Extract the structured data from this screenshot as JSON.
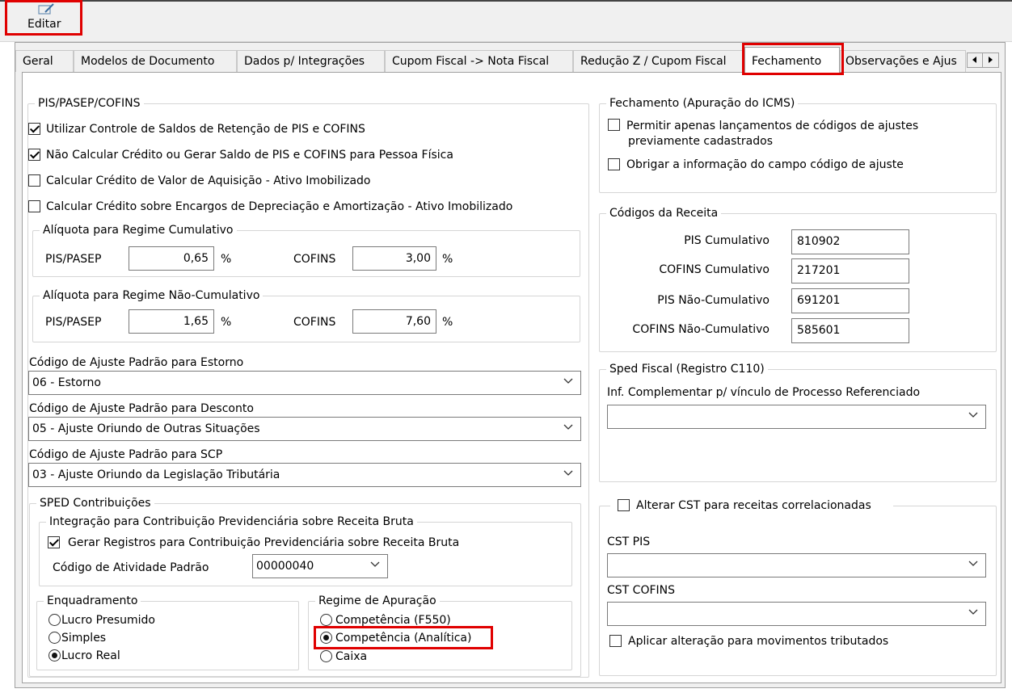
{
  "toolbar": {
    "edit_label": "Editar"
  },
  "tabs": [
    "Geral",
    "Modelos de Documento",
    "Dados p/ Integrações",
    "Cupom Fiscal -> Nota Fiscal",
    "Redução Z / Cupom Fiscal",
    "Fechamento",
    "Observações e Ajus"
  ],
  "active_tab": "Fechamento",
  "pis": {
    "legend": "PIS/PASEP/COFINS",
    "options": [
      {
        "label": "Utilizar Controle de Saldos de Retenção de PIS e COFINS",
        "checked": true
      },
      {
        "label": "Não Calcular Crédito ou Gerar Saldo de PIS e COFINS para Pessoa Física",
        "checked": true
      },
      {
        "label": "Calcular Crédito de Valor de Aquisição - Ativo Imobilizado",
        "checked": false
      },
      {
        "label": "Calcular Crédito sobre Encargos de Depreciação e Amortização - Ativo Imobilizado",
        "checked": false
      }
    ],
    "cumulativo": {
      "legend": "Alíquota para Regime Cumulativo",
      "pis_label": "PIS/PASEP",
      "pis_value": "0,65",
      "cofins_label": "COFINS",
      "cofins_value": "3,00",
      "unit": "%"
    },
    "nao_cumulativo": {
      "legend": "Alíquota para Regime Não-Cumulativo",
      "pis_label": "PIS/PASEP",
      "pis_value": "1,65",
      "cofins_label": "COFINS",
      "cofins_value": "7,60",
      "unit": "%"
    },
    "estorno": {
      "label": "Código de Ajuste Padrão para Estorno",
      "value": "06 - Estorno"
    },
    "desconto": {
      "label": "Código de Ajuste Padrão para Desconto",
      "value": "05 - Ajuste Oriundo de Outras Situações"
    },
    "scp": {
      "label": "Código de Ajuste Padrão para SCP",
      "value": "03 - Ajuste Oriundo da Legislação Tributária"
    }
  },
  "sped": {
    "legend": "SPED Contribuições",
    "integracao": {
      "legend": "Integração para Contribuição Previdenciária sobre Receita Bruta",
      "gerar_label": "Gerar Registros para Contribuição Previdenciária sobre Receita Bruta",
      "gerar_checked": true,
      "atividade_label": "Código de Atividade Padrão",
      "atividade_value": "00000040"
    },
    "enquadramento": {
      "legend": "Enquadramento",
      "options": [
        {
          "label": "Lucro Presumido",
          "selected": false
        },
        {
          "label": "Simples",
          "selected": false
        },
        {
          "label": "Lucro Real",
          "selected": true
        }
      ]
    },
    "regime": {
      "legend": "Regime de Apuração",
      "options": [
        {
          "label": "Competência (F550)",
          "selected": false
        },
        {
          "label": "Competência (Analítica)",
          "selected": true
        },
        {
          "label": "Caixa",
          "selected": false
        }
      ]
    }
  },
  "fechamento": {
    "legend": "Fechamento (Apuração do ICMS)",
    "permitir_line1": "Permitir apenas lançamentos de códigos de ajustes",
    "permitir_line2": "previamente cadastrados",
    "permitir_checked": false,
    "obrigar_label": "Obrigar a informação do campo código de ajuste",
    "obrigar_checked": false
  },
  "receita": {
    "legend": "Códigos da Receita",
    "rows": [
      {
        "label": "PIS Cumulativo",
        "value": "810902"
      },
      {
        "label": "COFINS Cumulativo",
        "value": "217201"
      },
      {
        "label": "PIS Não-Cumulativo",
        "value": "691201"
      },
      {
        "label": "COFINS Não-Cumulativo",
        "value": "585601"
      }
    ]
  },
  "sped_fiscal": {
    "legend": "Sped Fiscal (Registro C110)",
    "label": "Inf. Complementar p/ vínculo de Processo Referenciado",
    "value": ""
  },
  "cst": {
    "alterar_label": "Alterar CST para receitas correlacionadas",
    "alterar_checked": false,
    "pis_label": "CST PIS",
    "pis_value": "",
    "cofins_label": "CST COFINS",
    "cofins_value": "",
    "aplicar_label": "Aplicar alteração para movimentos tributados",
    "aplicar_checked": false
  },
  "colors": {
    "highlight": "#e00000",
    "border": "#d5d5d5",
    "panel_bg": "#f0f0f0"
  },
  "icons": {
    "edit": "edit-pencil-icon",
    "dropdown": "chevron-down-icon",
    "scroll_left": "scroll-left-icon",
    "scroll_right": "scroll-right-icon"
  }
}
